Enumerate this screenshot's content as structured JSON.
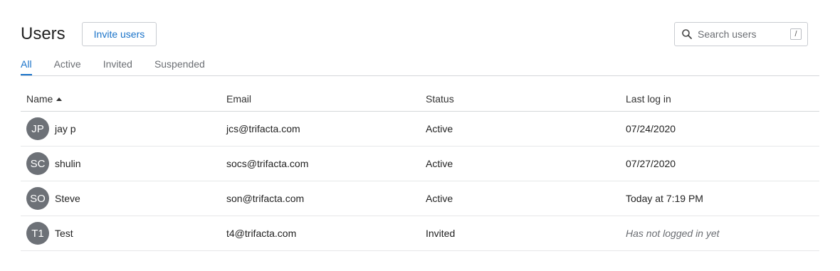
{
  "header": {
    "title": "Users",
    "invite_label": "Invite users"
  },
  "search": {
    "placeholder": "Search users",
    "shortcut": "/"
  },
  "tabs": [
    {
      "label": "All",
      "active": true
    },
    {
      "label": "Active",
      "active": false
    },
    {
      "label": "Invited",
      "active": false
    },
    {
      "label": "Suspended",
      "active": false
    }
  ],
  "table": {
    "columns": {
      "name": "Name",
      "email": "Email",
      "status": "Status",
      "last_login": "Last log in"
    },
    "sort": {
      "column": "name",
      "direction": "ascending"
    },
    "rows": [
      {
        "initials": "JP",
        "name": "jay p",
        "email": "jcs@trifacta.com",
        "status": "Active",
        "last_login": "07/24/2020"
      },
      {
        "initials": "SC",
        "name": "shulin",
        "email": "socs@trifacta.com",
        "status": "Active",
        "last_login": "07/27/2020"
      },
      {
        "initials": "SO",
        "name": "Steve",
        "email": "son@trifacta.com",
        "status": "Active",
        "last_login": "Today at 7:19 PM"
      },
      {
        "initials": "T1",
        "name": "Test",
        "email": "t4@trifacta.com",
        "status": "Invited",
        "last_login": "Has not logged in yet"
      }
    ]
  },
  "colors": {
    "accent": "#1a73c9",
    "avatar_bg": "#6d7177",
    "border": "#d5d7da"
  }
}
